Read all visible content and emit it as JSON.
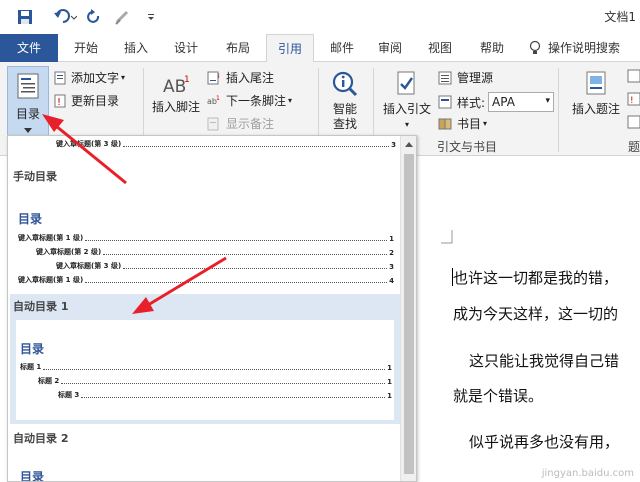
{
  "quick_access": {
    "doc_title": "文档1"
  },
  "tabs": [
    "文件",
    "开始",
    "插入",
    "设计",
    "布局",
    "引用",
    "邮件",
    "审阅",
    "视图",
    "帮助",
    "操作说明搜索"
  ],
  "ribbon": {
    "toc_button": "目录",
    "add_text": "添加文字",
    "update_toc": "更新目录",
    "insert_footnote": "插入脚注",
    "insert_endnote": "插入尾注",
    "next_footnote": "下一条脚注",
    "show_notes": "显示备注",
    "smart_lookup_1": "智能",
    "smart_lookup_2": "查找",
    "insert_citation": "插入引文",
    "manage_sources": "管理源",
    "style_label": "样式:",
    "style_value": "APA",
    "bibliography": "书目",
    "citations_group": "引文与书目",
    "insert_caption": "插入题注",
    "captions_group_partial": "题"
  },
  "gallery": {
    "top_partial_line": {
      "label": "键入章标题(第 3 级)",
      "page": "3"
    },
    "manual": {
      "header": "手动目录",
      "title": "目录",
      "lines": [
        {
          "label": "键入章标题(第 1 级)",
          "page": "1"
        },
        {
          "label": "键入章标题(第 2 级)",
          "page": "2"
        },
        {
          "label": "键入章标题(第 3 级)",
          "page": "3"
        },
        {
          "label": "键入章标题(第 1 级)",
          "page": "4"
        }
      ]
    },
    "auto1": {
      "header": "自动目录 1",
      "title": "目录",
      "lines": [
        {
          "label": "标题 1",
          "page": "1"
        },
        {
          "label": "标题 2",
          "page": "1"
        },
        {
          "label": "标题 3",
          "page": "1"
        }
      ]
    },
    "auto2": {
      "header": "自动目录 2",
      "title": "目录"
    }
  },
  "document": {
    "lines": [
      "也许这一切都是我的错，",
      "成为今天这样，这一切的",
      "这只能让我觉得自己错",
      "就是个错误。",
      "似乎说再多也没有用，"
    ],
    "watermark": "jingyan.baidu.com"
  }
}
